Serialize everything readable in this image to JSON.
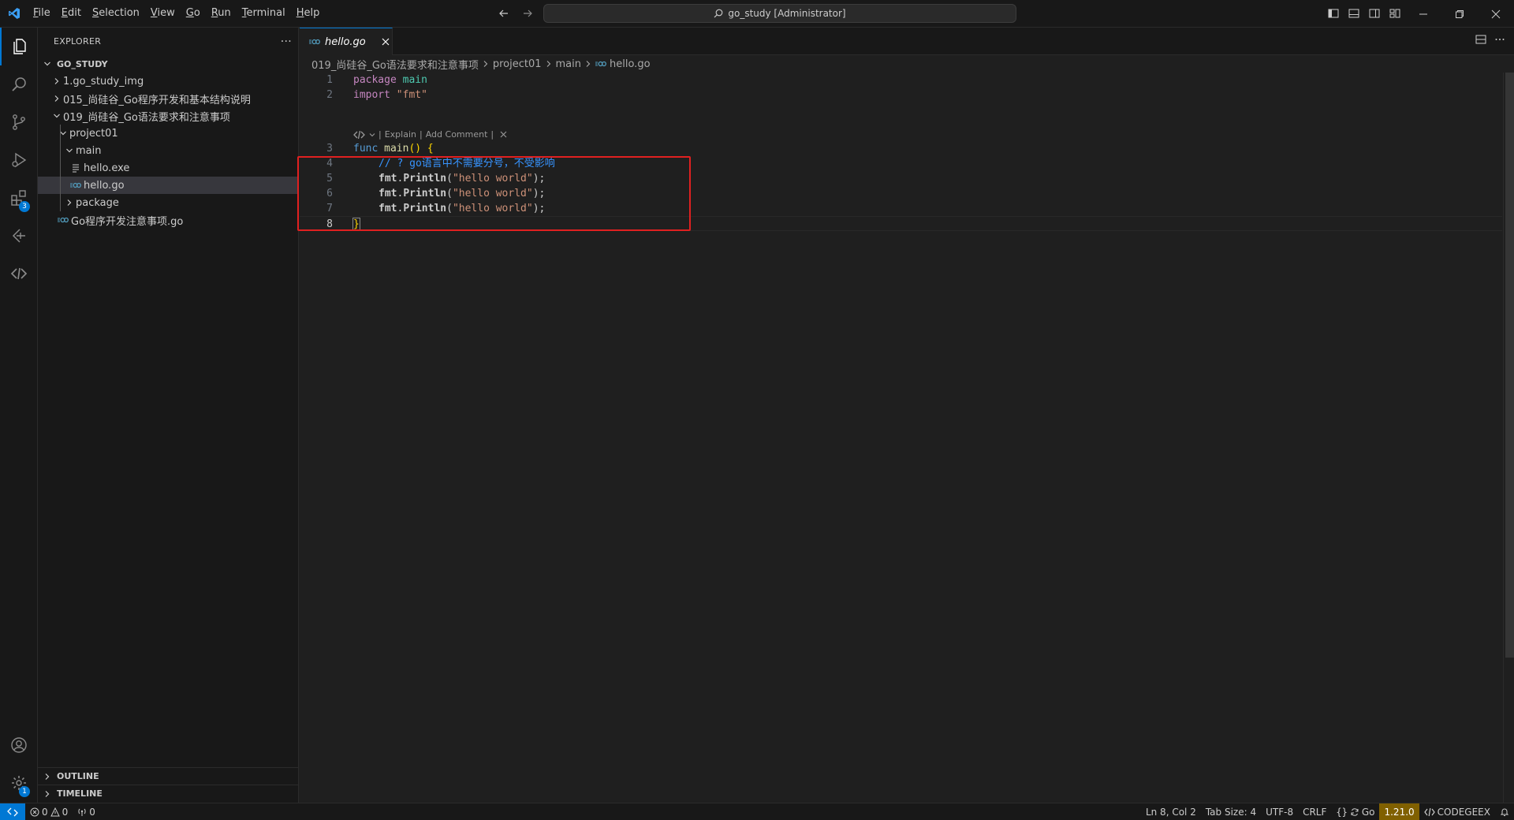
{
  "titlebar": {
    "menus": [
      "File",
      "Edit",
      "Selection",
      "View",
      "Go",
      "Run",
      "Terminal",
      "Help"
    ],
    "command_center": "go_study [Administrator]"
  },
  "activity_bar": {
    "items": [
      "explorer-icon",
      "search-icon",
      "source-control-icon",
      "run-debug-icon",
      "extensions-icon",
      "remote-icon",
      "codegeex-icon"
    ],
    "extensions_badge": "3",
    "settings_badge": "1"
  },
  "sidebar": {
    "title": "EXPLORER",
    "more": "···",
    "root": "GO_STUDY",
    "tree": [
      {
        "label": "1.go_study_img",
        "type": "folder"
      },
      {
        "label": "015_尚硅谷_Go程序开发和基本结构说明",
        "type": "folder"
      },
      {
        "label": "019_尚硅谷_Go语法要求和注意事项",
        "type": "folder-open"
      },
      {
        "label": "project01",
        "type": "folder-open"
      },
      {
        "label": "main",
        "type": "folder-open"
      },
      {
        "label": "hello.exe",
        "type": "file"
      },
      {
        "label": "hello.go",
        "type": "go",
        "selected": true
      },
      {
        "label": "package",
        "type": "folder"
      },
      {
        "label": "Go程序开发注意事项.go",
        "type": "go"
      }
    ],
    "outline": "OUTLINE",
    "timeline": "TIMELINE"
  },
  "editor": {
    "tab_label": "hello.go",
    "breadcrumb": [
      "019_尚硅谷_Go语法要求和注意事项",
      "project01",
      "main",
      "hello.go"
    ],
    "codelens": {
      "explain": "Explain",
      "add_comment": "Add Comment",
      "sep": "|"
    },
    "line_numbers": [
      "1",
      "2",
      "3",
      "4",
      "5",
      "6",
      "7",
      "8"
    ],
    "code": {
      "l1_kw": "package",
      "l1_name": "main",
      "l2_kw": "import",
      "l2_str": "\"fmt\"",
      "l3_kw": "func",
      "l3_fn": "main",
      "l3_rest": "() {",
      "l4_comment": "// ? go语言中不需要分号，不受影响",
      "println_pkg": "fmt",
      "println_fn": "Println",
      "println_arg": "\"hello world\"",
      "l8": "}"
    }
  },
  "statusbar": {
    "errors": "0",
    "warnings": "0",
    "ports": "0",
    "position": "Ln 8, Col 2",
    "tab_size": "Tab Size: 4",
    "encoding": "UTF-8",
    "eol": "CRLF",
    "language": "Go",
    "go_version": "1.21.0",
    "codegeex": "CODEGEEX"
  },
  "colors": {
    "accent": "#0078d4",
    "highlight_box": "#e02020",
    "go_version_bg": "#806000"
  }
}
